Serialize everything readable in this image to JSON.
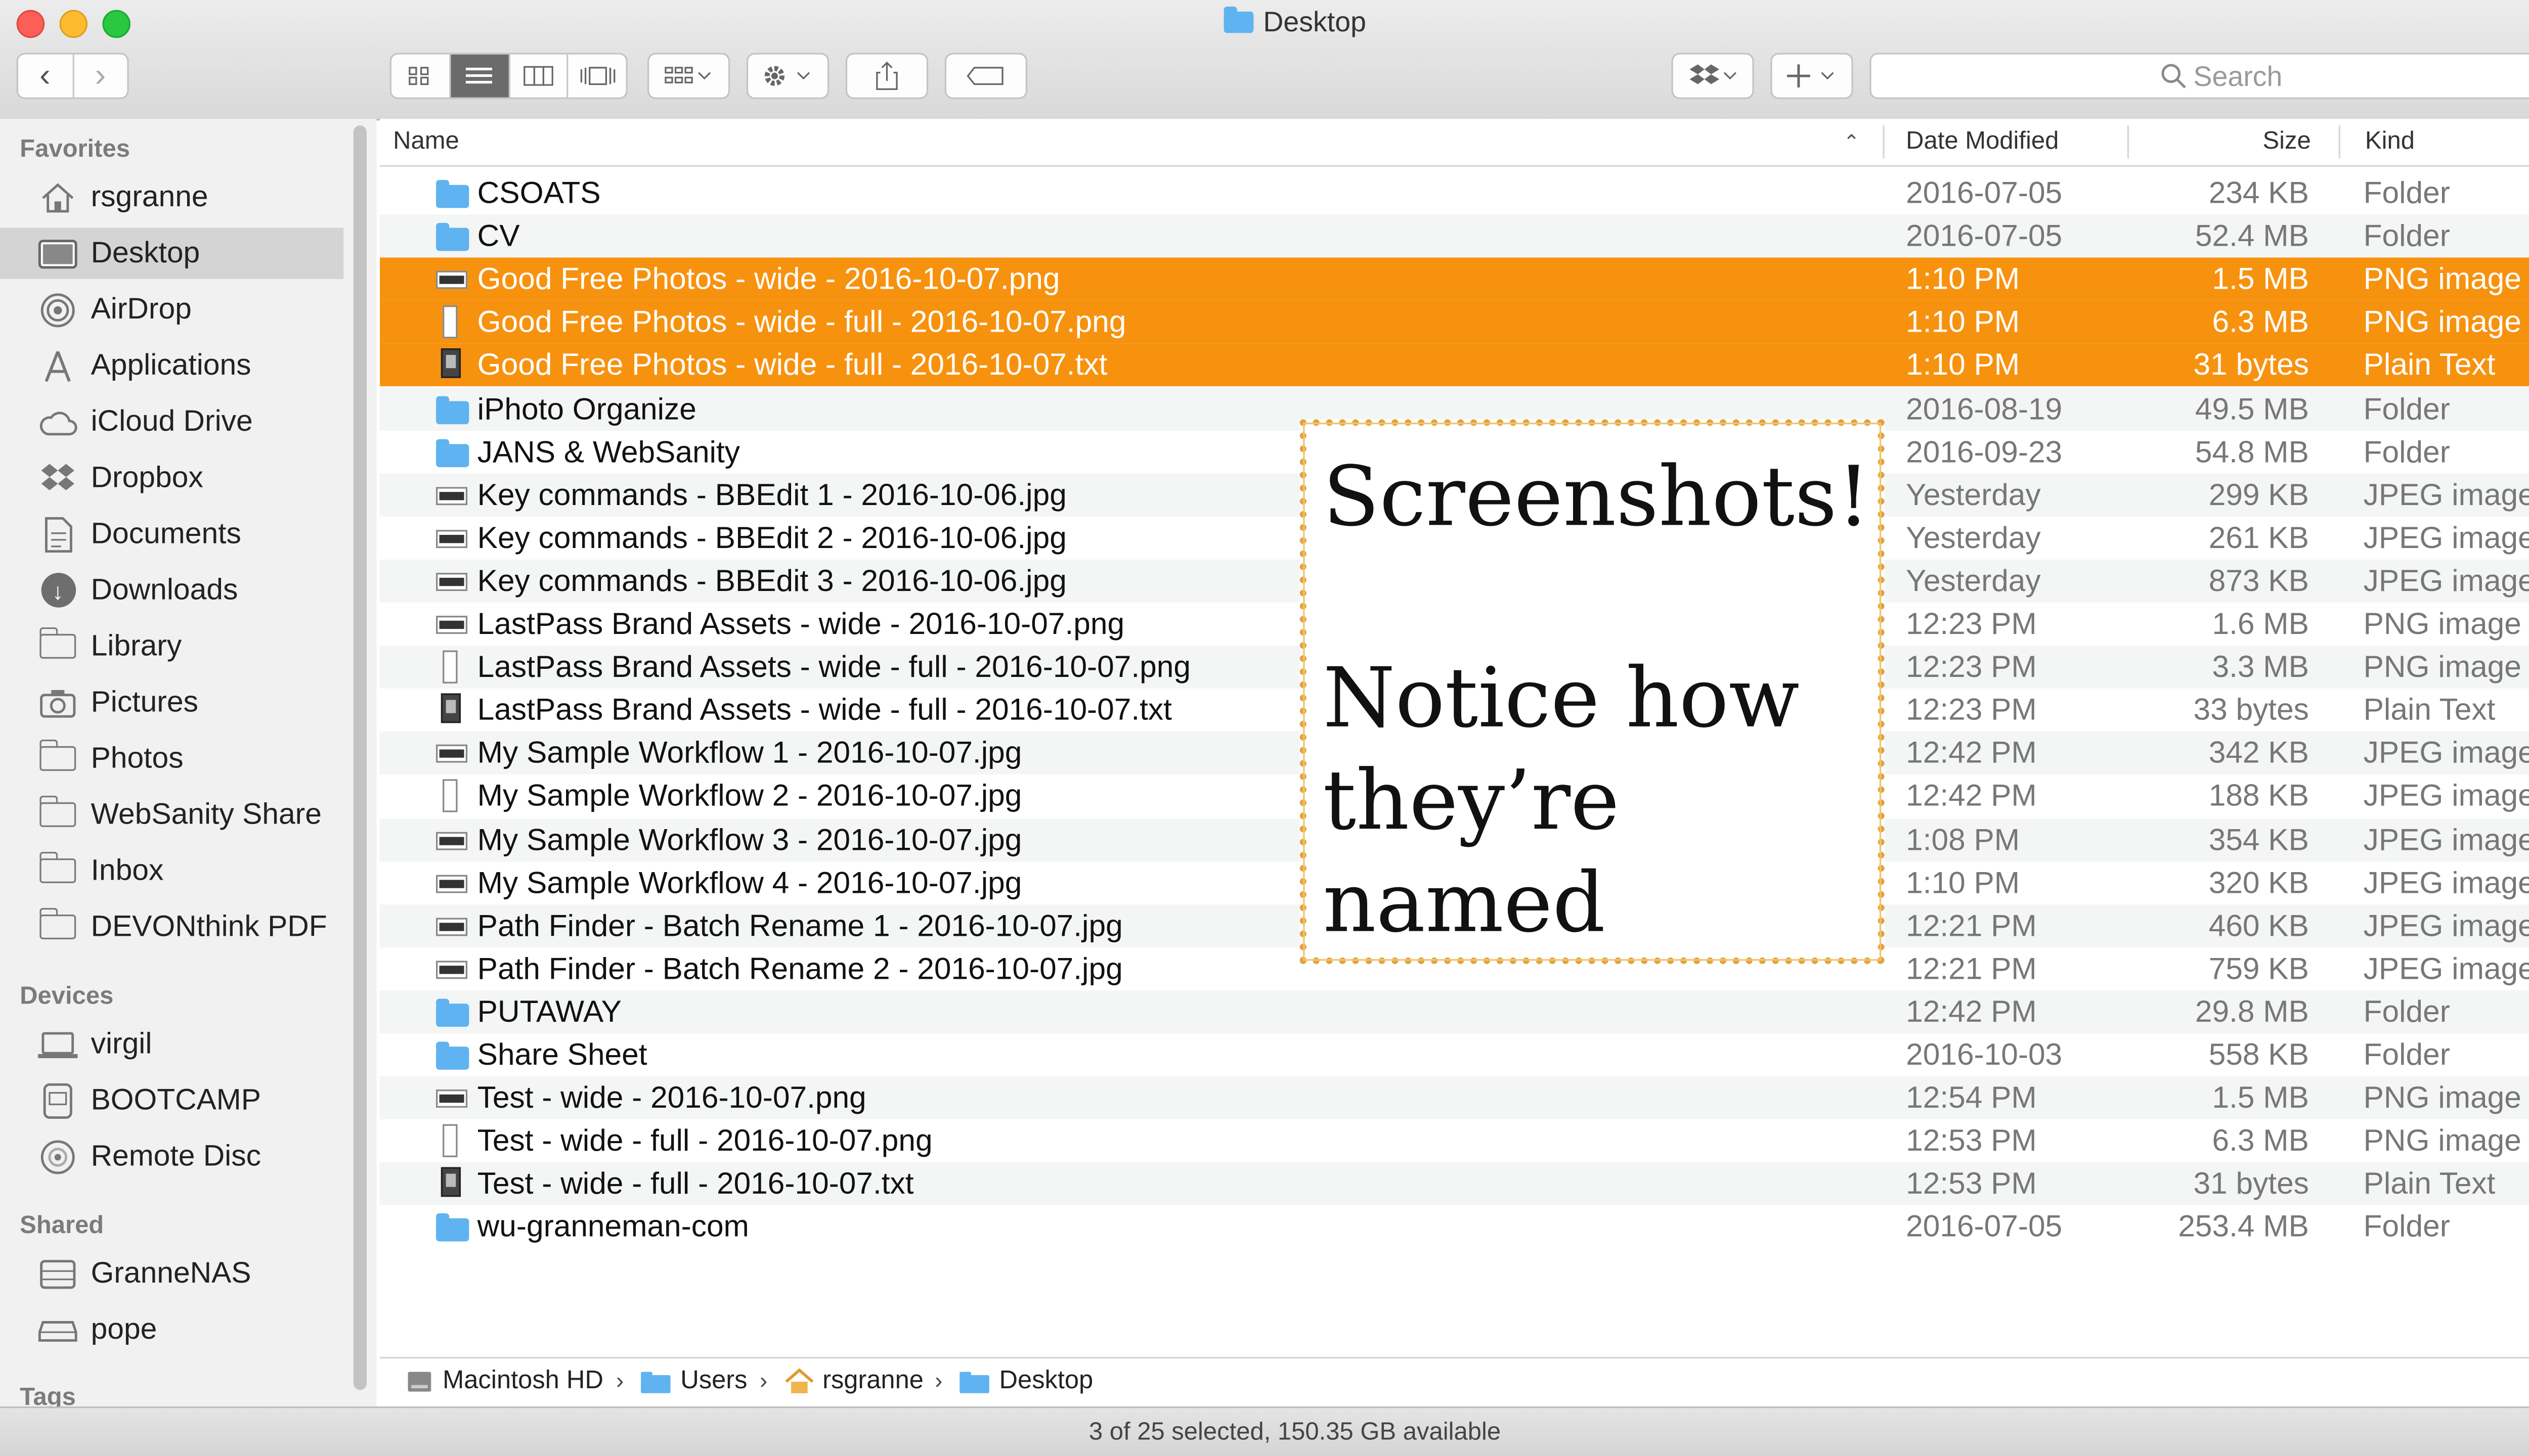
{
  "window": {
    "title": "Desktop"
  },
  "toolbar": {
    "back_icon": "chevron-left-icon",
    "forward_icon": "chevron-right-icon",
    "view_modes": [
      "icon-view",
      "list-view",
      "column-view",
      "cover-flow-view"
    ],
    "active_view": "list-view",
    "search_placeholder": "Search"
  },
  "sidebar": {
    "sections": {
      "favorites": "Favorites",
      "devices": "Devices",
      "shared": "Shared",
      "tags": "Tags"
    },
    "favorites": [
      {
        "label": "rsgranne",
        "icon": "home-icon"
      },
      {
        "label": "Desktop",
        "icon": "desktop-icon",
        "selected": true
      },
      {
        "label": "AirDrop",
        "icon": "airdrop-icon"
      },
      {
        "label": "Applications",
        "icon": "applications-icon"
      },
      {
        "label": "iCloud Drive",
        "icon": "cloud-icon"
      },
      {
        "label": "Dropbox",
        "icon": "dropbox-icon"
      },
      {
        "label": "Documents",
        "icon": "documents-icon"
      },
      {
        "label": "Downloads",
        "icon": "download-icon"
      },
      {
        "label": "Library",
        "icon": "folder-icon"
      },
      {
        "label": "Pictures",
        "icon": "camera-icon"
      },
      {
        "label": "Photos",
        "icon": "folder-icon"
      },
      {
        "label": "WebSanity Share",
        "icon": "folder-icon"
      },
      {
        "label": "Inbox",
        "icon": "folder-icon"
      },
      {
        "label": "DEVONthink PDF",
        "icon": "folder-icon"
      }
    ],
    "devices": [
      {
        "label": "virgil",
        "icon": "laptop-icon"
      },
      {
        "label": "BOOTCAMP",
        "icon": "drive-icon"
      },
      {
        "label": "Remote Disc",
        "icon": "disc-icon"
      }
    ],
    "shared": [
      {
        "label": "GranneNAS",
        "icon": "server-icon"
      },
      {
        "label": "pope",
        "icon": "network-drive-icon"
      }
    ]
  },
  "columns": {
    "name": "Name",
    "date": "Date Modified",
    "size": "Size",
    "kind": "Kind"
  },
  "files": [
    {
      "name": "CSOATS",
      "date": "2016-07-05",
      "size": "234 KB",
      "kind": "Folder",
      "icon": "folder"
    },
    {
      "name": "CV",
      "date": "2016-07-05",
      "size": "52.4 MB",
      "kind": "Folder",
      "icon": "folder"
    },
    {
      "name": "Good Free Photos - wide - 2016-10-07.png",
      "date": "1:10 PM",
      "size": "1.5 MB",
      "kind": "PNG image",
      "icon": "wide",
      "selected": true
    },
    {
      "name": "Good Free Photos - wide - full - 2016-10-07.png",
      "date": "1:10 PM",
      "size": "6.3 MB",
      "kind": "PNG image",
      "icon": "tall",
      "selected": true
    },
    {
      "name": "Good Free Photos - wide - full - 2016-10-07.txt",
      "date": "1:10 PM",
      "size": "31 bytes",
      "kind": "Plain Text",
      "icon": "txt",
      "selected": true
    },
    {
      "name": "iPhoto Organize",
      "date": "2016-08-19",
      "size": "49.5 MB",
      "kind": "Folder",
      "icon": "folder"
    },
    {
      "name": "JANS & WebSanity",
      "date": "2016-09-23",
      "size": "54.8 MB",
      "kind": "Folder",
      "icon": "folder"
    },
    {
      "name": "Key commands - BBEdit 1 - 2016-10-06.jpg",
      "date": "Yesterday",
      "size": "299 KB",
      "kind": "JPEG image",
      "icon": "wide"
    },
    {
      "name": "Key commands - BBEdit 2 - 2016-10-06.jpg",
      "date": "Yesterday",
      "size": "261 KB",
      "kind": "JPEG image",
      "icon": "wide"
    },
    {
      "name": "Key commands - BBEdit 3 - 2016-10-06.jpg",
      "date": "Yesterday",
      "size": "873 KB",
      "kind": "JPEG image",
      "icon": "wide"
    },
    {
      "name": "LastPass Brand Assets - wide - 2016-10-07.png",
      "date": "12:23 PM",
      "size": "1.6 MB",
      "kind": "PNG image",
      "icon": "wide"
    },
    {
      "name": "LastPass Brand Assets - wide - full - 2016-10-07.png",
      "date": "12:23 PM",
      "size": "3.3 MB",
      "kind": "PNG image",
      "icon": "tall"
    },
    {
      "name": "LastPass Brand Assets - wide - full - 2016-10-07.txt",
      "date": "12:23 PM",
      "size": "33 bytes",
      "kind": "Plain Text",
      "icon": "txt"
    },
    {
      "name": "My Sample Workflow 1 - 2016-10-07.jpg",
      "date": "12:42 PM",
      "size": "342 KB",
      "kind": "JPEG image",
      "icon": "wide"
    },
    {
      "name": "My Sample Workflow 2 - 2016-10-07.jpg",
      "date": "12:42 PM",
      "size": "188 KB",
      "kind": "JPEG image",
      "icon": "tall"
    },
    {
      "name": "My Sample Workflow 3 - 2016-10-07.jpg",
      "date": "1:08 PM",
      "size": "354 KB",
      "kind": "JPEG image",
      "icon": "wide"
    },
    {
      "name": "My Sample Workflow 4 - 2016-10-07.jpg",
      "date": "1:10 PM",
      "size": "320 KB",
      "kind": "JPEG image",
      "icon": "wide"
    },
    {
      "name": "Path Finder - Batch Rename 1 - 2016-10-07.jpg",
      "date": "12:21 PM",
      "size": "460 KB",
      "kind": "JPEG image",
      "icon": "wide"
    },
    {
      "name": "Path Finder - Batch Rename 2 - 2016-10-07.jpg",
      "date": "12:21 PM",
      "size": "759 KB",
      "kind": "JPEG image",
      "icon": "wide"
    },
    {
      "name": "PUTAWAY",
      "date": "12:42 PM",
      "size": "29.8 MB",
      "kind": "Folder",
      "icon": "folder"
    },
    {
      "name": "Share Sheet",
      "date": "2016-10-03",
      "size": "558 KB",
      "kind": "Folder",
      "icon": "folder"
    },
    {
      "name": "Test - wide - 2016-10-07.png",
      "date": "12:54 PM",
      "size": "1.5 MB",
      "kind": "PNG image",
      "icon": "wide"
    },
    {
      "name": "Test - wide - full - 2016-10-07.png",
      "date": "12:53 PM",
      "size": "6.3 MB",
      "kind": "PNG image",
      "icon": "tall"
    },
    {
      "name": "Test - wide - full - 2016-10-07.txt",
      "date": "12:53 PM",
      "size": "31 bytes",
      "kind": "Plain Text",
      "icon": "txt"
    },
    {
      "name": "wu-granneman-com",
      "date": "2016-07-05",
      "size": "253.4 MB",
      "kind": "Folder",
      "icon": "folder"
    }
  ],
  "callout": {
    "line1": "Screenshots!",
    "line2": "Notice how",
    "line3": "they’re",
    "line4": "named",
    "border_color": "#e3a33a"
  },
  "path_bar": [
    {
      "label": "Macintosh HD",
      "icon": "hard-drive-icon"
    },
    {
      "label": "Users",
      "icon": "folder-icon"
    },
    {
      "label": "rsgranne",
      "icon": "home-icon"
    },
    {
      "label": "Desktop",
      "icon": "folder-icon"
    }
  ],
  "status": "3 of 25 selected, 150.35 GB available",
  "colors": {
    "selection": "#f7920f",
    "folder": "#5fb3f0"
  }
}
